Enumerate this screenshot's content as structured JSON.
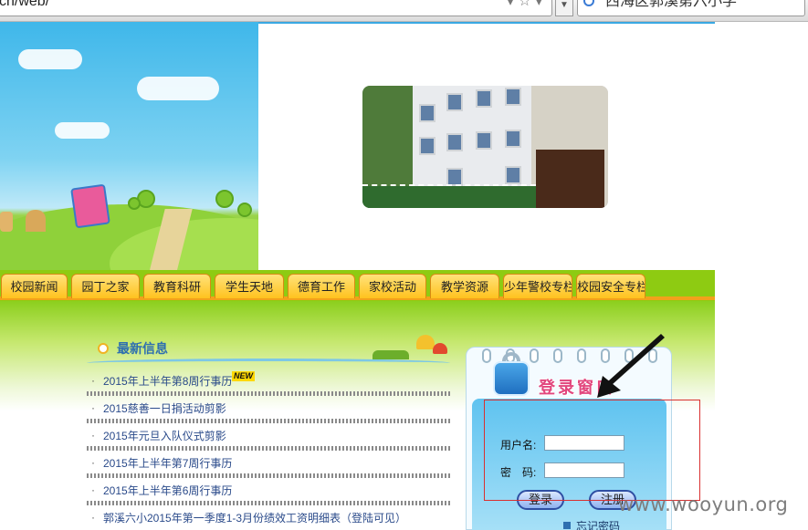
{
  "browser": {
    "url": "cn/web/",
    "search_text": "西海区郭溪第六小学",
    "url_icons": "▾ ☆ ▾"
  },
  "nav": {
    "tabs": [
      "校园新闻",
      "园丁之家",
      "教育科研",
      "学生天地",
      "德育工作",
      "家校活动",
      "教学资源",
      "少年警校专栏",
      "校园安全专栏"
    ]
  },
  "news": {
    "title": "最新信息",
    "new_badge": "NEW",
    "items": [
      "2015年上半年第8周行事历",
      "2015慈善一日捐活动剪影",
      "2015年元旦入队仪式剪影",
      "2015年上半年第7周行事历",
      "2015年上半年第6周行事历",
      "郭溪六小2015年第一季度1-3月份绩效工资明细表（登陆可见）"
    ]
  },
  "login": {
    "title": "登录窗口",
    "username_label": "用户名:",
    "password_label": "密　码:",
    "login_button": "登录",
    "register_button": "注册",
    "forgot_password": "忘记密码"
  },
  "watermark": "www.wooyun.org",
  "colors": {
    "nav_green": "#8ecb12",
    "tab_yellow": "#ffc21e",
    "news_title_blue": "#2e6fb0",
    "annotation_red": "#d93030"
  }
}
